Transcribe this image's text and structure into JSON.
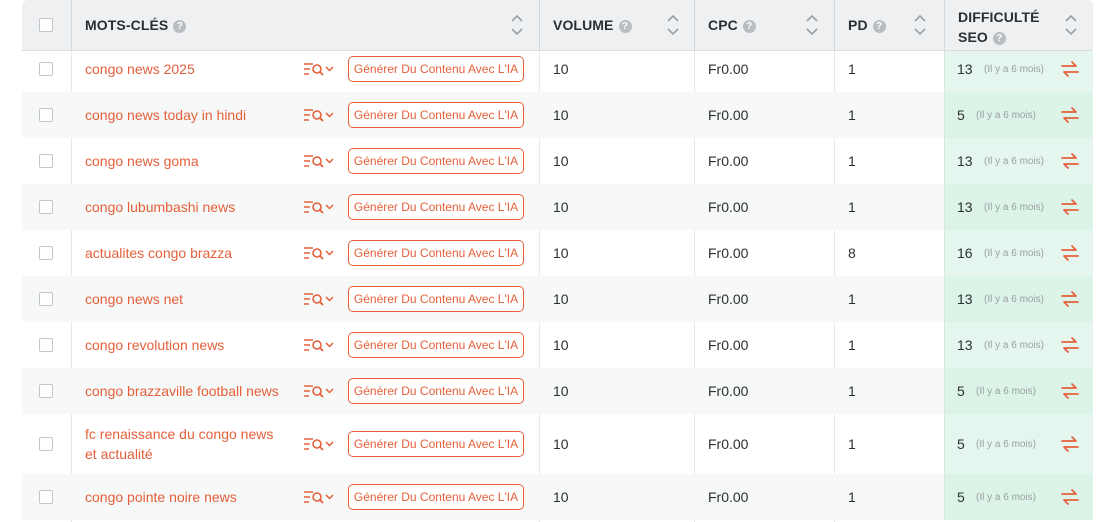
{
  "header": {
    "keywords": "MOTS-CLÉS",
    "volume": "VOLUME",
    "cpc": "CPC",
    "pd": "PD",
    "seo_line1": "DIFFICULTÉ",
    "seo_line2": "SEO",
    "help": "?"
  },
  "generate_label": "Générer Du Contenu Avec L'IA",
  "colors": {
    "accent": "#e5603a",
    "seo_bg": "#e5f6ee"
  },
  "rows": [
    {
      "keyword": "congo news 2025",
      "volume": "10",
      "cpc": "Fr0.00",
      "pd": "1",
      "seo": "13",
      "age": "(Il y a 6 mois)"
    },
    {
      "keyword": "congo news today in hindi",
      "volume": "10",
      "cpc": "Fr0.00",
      "pd": "1",
      "seo": "5",
      "age": "(Il y a 6 mois)"
    },
    {
      "keyword": "congo news goma",
      "volume": "10",
      "cpc": "Fr0.00",
      "pd": "1",
      "seo": "13",
      "age": "(Il y a 6 mois)"
    },
    {
      "keyword": "congo lubumbashi news",
      "volume": "10",
      "cpc": "Fr0.00",
      "pd": "1",
      "seo": "13",
      "age": "(Il y a 6 mois)"
    },
    {
      "keyword": "actualites congo brazza",
      "volume": "10",
      "cpc": "Fr0.00",
      "pd": "8",
      "seo": "16",
      "age": "(Il y a 6 mois)"
    },
    {
      "keyword": "congo news net",
      "volume": "10",
      "cpc": "Fr0.00",
      "pd": "1",
      "seo": "13",
      "age": "(Il y a 6 mois)"
    },
    {
      "keyword": "congo revolution news",
      "volume": "10",
      "cpc": "Fr0.00",
      "pd": "1",
      "seo": "13",
      "age": "(Il y a 6 mois)"
    },
    {
      "keyword": "congo brazzaville football news",
      "volume": "10",
      "cpc": "Fr0.00",
      "pd": "1",
      "seo": "5",
      "age": "(Il y a 6 mois)"
    },
    {
      "keyword": "fc renaissance du congo news et actualité",
      "volume": "10",
      "cpc": "Fr0.00",
      "pd": "1",
      "seo": "5",
      "age": "(Il y a 6 mois)"
    },
    {
      "keyword": "congo pointe noire news",
      "volume": "10",
      "cpc": "Fr0.00",
      "pd": "1",
      "seo": "5",
      "age": "(Il y a 6 mois)"
    }
  ]
}
